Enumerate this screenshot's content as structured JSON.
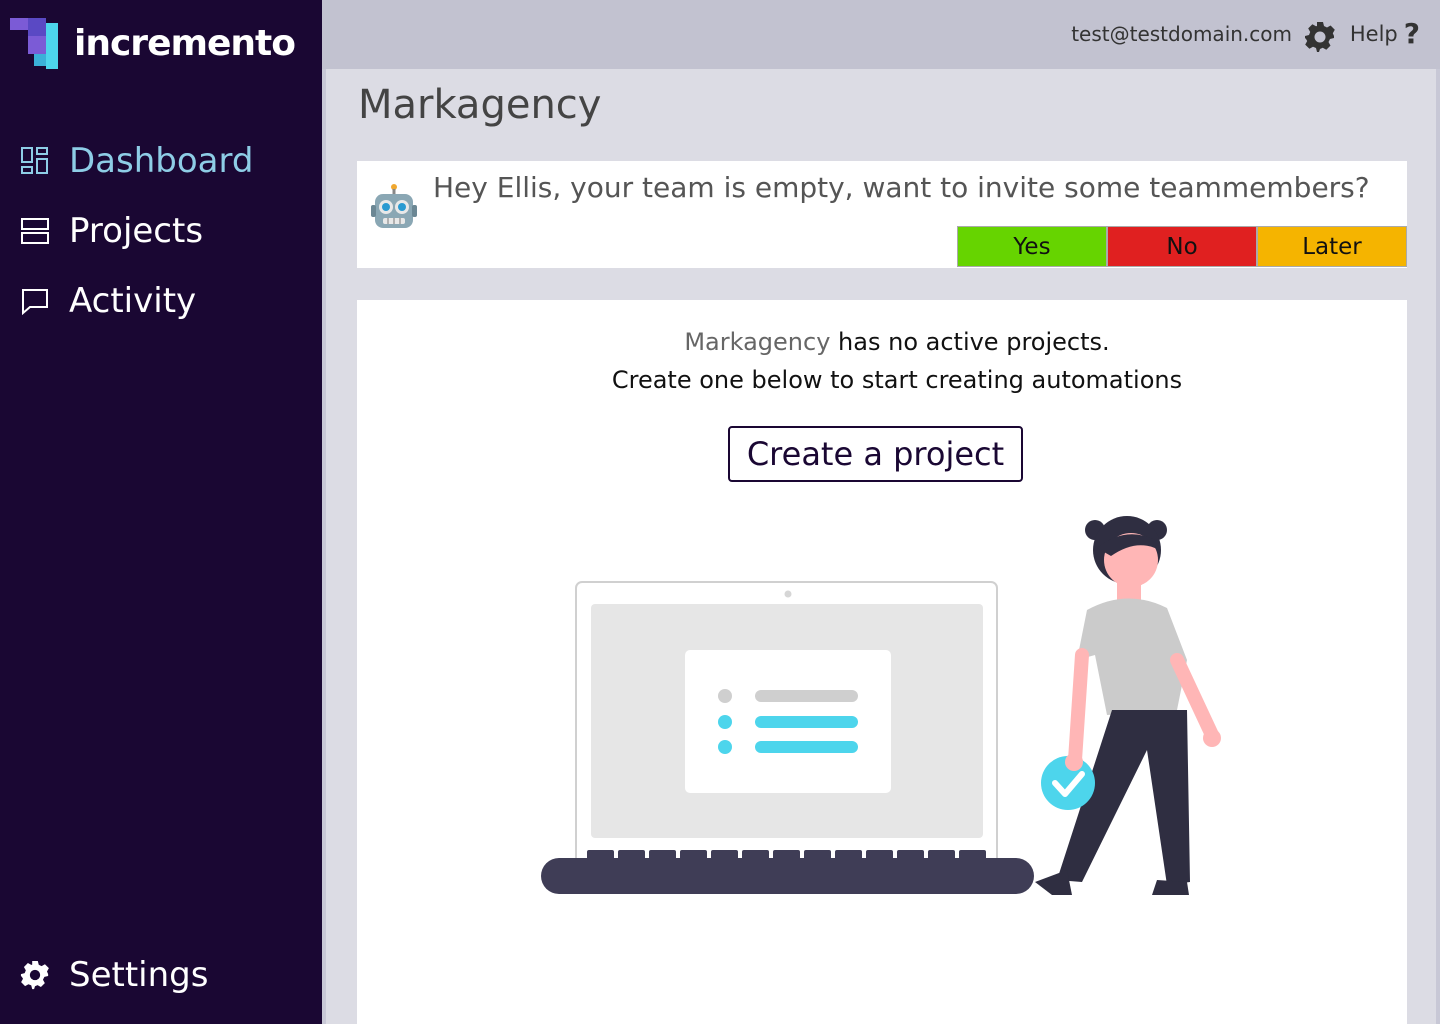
{
  "brand": {
    "name": "incremento"
  },
  "sidebar": {
    "items": [
      {
        "label": "Dashboard",
        "icon": "dashboard-icon",
        "active": true
      },
      {
        "label": "Projects",
        "icon": "projects-icon",
        "active": false
      },
      {
        "label": "Activity",
        "icon": "activity-icon",
        "active": false
      }
    ],
    "settings": {
      "label": "Settings",
      "icon": "gear-icon"
    }
  },
  "topbar": {
    "email": "test@testdomain.com",
    "help_label": "Help",
    "help_icon": "?"
  },
  "page": {
    "title": "Markagency"
  },
  "notice": {
    "message": "Hey Ellis, your team is empty, want to invite some teammembers?",
    "buttons": {
      "yes": "Yes",
      "no": "No",
      "later": "Later"
    }
  },
  "empty_state": {
    "org_name": "Markagency",
    "line1_rest": " has no active projects.",
    "line2": "Create one below to start creating automations",
    "cta": "Create a project"
  },
  "colors": {
    "sidebar_bg": "#1a0733",
    "active_nav": "#8ecde6",
    "accent_cyan": "#4dd5ec",
    "yes": "#66d400",
    "no": "#e02020",
    "later": "#f5b400"
  }
}
